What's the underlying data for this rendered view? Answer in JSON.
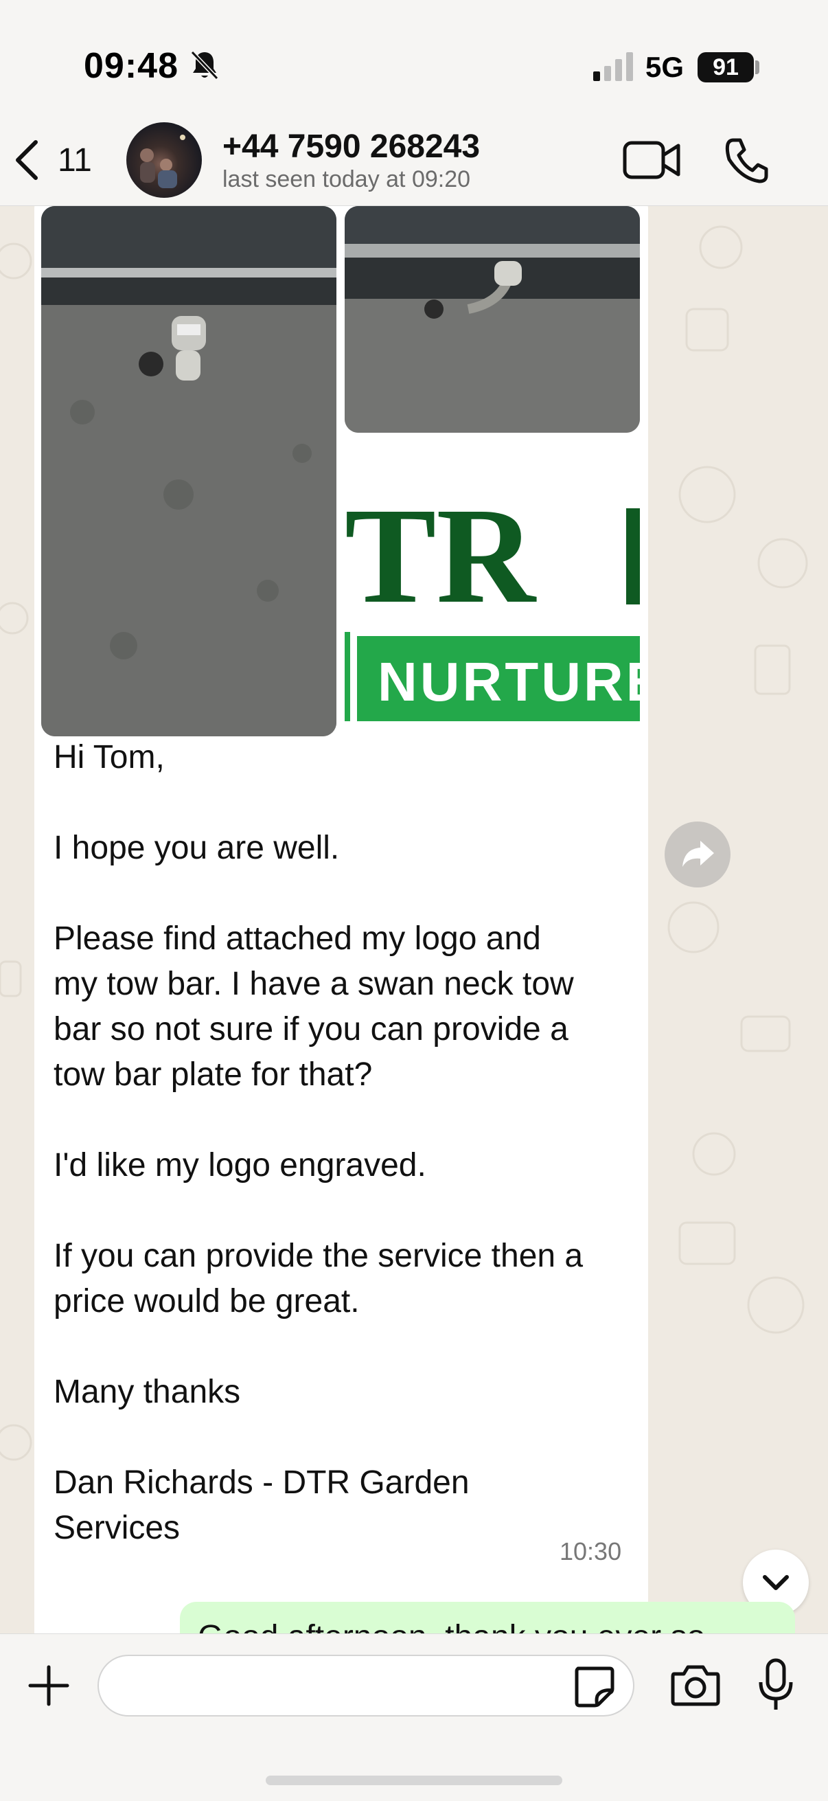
{
  "status_bar": {
    "time": "09:48",
    "network": "5G",
    "battery": "91"
  },
  "header": {
    "back_count": "11",
    "contact_name": "+44 7590 268243",
    "contact_status": "last seen today at 09:20"
  },
  "message": {
    "logo_text_main": "TR",
    "logo_text_banner": "NURTURE",
    "body": "Hi Tom,\n\nI hope you are well.\n\nPlease find attached my logo and\nmy tow bar. I have a swan neck tow\nbar so not sure if you can provide a\ntow bar plate for that?\n\nI'd like my logo engraved.\n\nIf you can provide the service then a\nprice would be great.\n\nMany thanks\n\nDan Richards - DTR Garden\nServices",
    "time": "10:30"
  },
  "outgoing": {
    "text_partial": "Good afternoon, thank you ever so"
  },
  "composer": {
    "placeholder": ""
  },
  "colors": {
    "chat_bg": "#efeae2",
    "outgoing_bubble": "#d9fdd3",
    "logo_green_dark": "#0f5a22",
    "logo_green_light": "#23a84a"
  },
  "icons": [
    "bell-off-icon",
    "signal-icon",
    "battery-icon",
    "chevron-left-icon",
    "video-call-icon",
    "phone-icon",
    "forward-icon",
    "chevron-down-icon",
    "plus-icon",
    "sticker-icon",
    "camera-icon",
    "mic-icon"
  ]
}
